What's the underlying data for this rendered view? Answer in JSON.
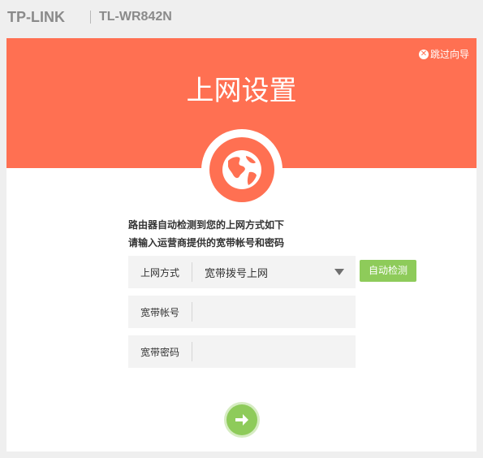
{
  "header": {
    "brand": "TP-LINK",
    "model": "TL-WR842N"
  },
  "banner": {
    "skip_label": "跳过向导",
    "title": "上网设置",
    "icon": "globe-icon"
  },
  "form": {
    "desc_line1": "路由器自动检测到您的上网方式如下",
    "desc_line2": "请输入运营商提供的宽带帐号和密码",
    "conn_type_label": "上网方式",
    "conn_type_value": "宽带拨号上网",
    "detect_label": "自动检测",
    "account_label": "宽带帐号",
    "account_value": "",
    "password_label": "宽带密码",
    "password_value": ""
  },
  "actions": {
    "next_icon": "arrow-right-icon"
  },
  "colors": {
    "accent": "#ff7052",
    "green": "#8ecb5a",
    "field_bg": "#f3f3f3"
  }
}
